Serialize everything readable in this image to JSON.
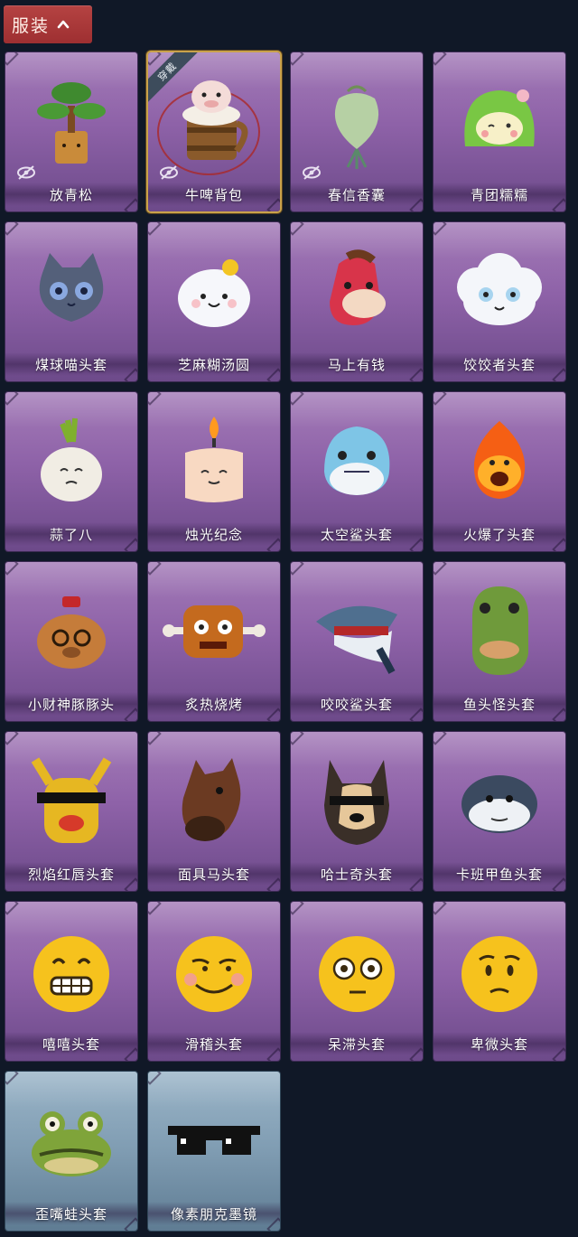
{
  "header": {
    "title": "服装",
    "toggle_icon": "chevron-up-icon"
  },
  "items": [
    {
      "name": "放青松",
      "icon": "pine-bonsai",
      "hidden": true,
      "equipped": false,
      "theme": "purple"
    },
    {
      "name": "牛啤背包",
      "icon": "cow-beer-mug",
      "hidden": true,
      "equipped": true,
      "badge": "穿戴",
      "theme": "purple"
    },
    {
      "name": "春信香囊",
      "icon": "green-sachet",
      "hidden": true,
      "equipped": false,
      "theme": "purple"
    },
    {
      "name": "青团糯糯",
      "icon": "green-rice-ball",
      "hidden": false,
      "equipped": false,
      "theme": "purple"
    },
    {
      "name": "煤球喵头套",
      "icon": "grey-cat-head",
      "hidden": false,
      "equipped": false,
      "theme": "purple"
    },
    {
      "name": "芝麻糊汤圆",
      "icon": "white-dumpling",
      "hidden": false,
      "equipped": false,
      "theme": "purple"
    },
    {
      "name": "马上有钱",
      "icon": "red-horse-head",
      "hidden": false,
      "equipped": false,
      "theme": "purple"
    },
    {
      "name": "饺饺者头套",
      "icon": "dumpling-cloud-head",
      "hidden": false,
      "equipped": false,
      "theme": "purple"
    },
    {
      "name": "蒜了八",
      "icon": "garlic-head",
      "hidden": false,
      "equipped": false,
      "theme": "purple"
    },
    {
      "name": "烛光纪念",
      "icon": "candle-head",
      "hidden": false,
      "equipped": false,
      "theme": "purple"
    },
    {
      "name": "太空鲨头套",
      "icon": "blue-shark-head",
      "hidden": false,
      "equipped": false,
      "theme": "purple"
    },
    {
      "name": "火爆了头套",
      "icon": "fire-head",
      "hidden": false,
      "equipped": false,
      "theme": "purple"
    },
    {
      "name": "小财神豚豚头",
      "icon": "capybara-head",
      "hidden": false,
      "equipped": false,
      "theme": "purple"
    },
    {
      "name": "炙热烧烤",
      "icon": "bbq-meat-head",
      "hidden": false,
      "equipped": false,
      "theme": "purple"
    },
    {
      "name": "咬咬鲨头套",
      "icon": "biting-shark-head",
      "hidden": false,
      "equipped": false,
      "theme": "purple"
    },
    {
      "name": "鱼头怪头套",
      "icon": "fish-monster-head",
      "hidden": false,
      "equipped": false,
      "theme": "purple"
    },
    {
      "name": "烈焰红唇头套",
      "icon": "yellow-lips-head",
      "hidden": false,
      "equipped": false,
      "theme": "purple"
    },
    {
      "name": "面具马头套",
      "icon": "horse-mask-head",
      "hidden": false,
      "equipped": false,
      "theme": "purple"
    },
    {
      "name": "哈士奇头套",
      "icon": "husky-head",
      "hidden": false,
      "equipped": false,
      "theme": "purple"
    },
    {
      "name": "卡班甲鱼头套",
      "icon": "puffer-fish-head",
      "hidden": false,
      "equipped": false,
      "theme": "purple"
    },
    {
      "name": "嘻嘻头套",
      "icon": "grin-emoji-head",
      "hidden": false,
      "equipped": false,
      "theme": "purple"
    },
    {
      "name": "滑稽头套",
      "icon": "funny-emoji-head",
      "hidden": false,
      "equipped": false,
      "theme": "purple"
    },
    {
      "name": "呆滞头套",
      "icon": "dazed-emoji-head",
      "hidden": false,
      "equipped": false,
      "theme": "purple"
    },
    {
      "name": "卑微头套",
      "icon": "humble-emoji-head",
      "hidden": false,
      "equipped": false,
      "theme": "purple"
    },
    {
      "name": "歪嘴蛙头套",
      "icon": "frog-head",
      "hidden": false,
      "equipped": false,
      "theme": "blue"
    },
    {
      "name": "像素朋克墨镜",
      "icon": "pixel-sunglasses",
      "hidden": false,
      "equipped": false,
      "theme": "blue"
    }
  ]
}
